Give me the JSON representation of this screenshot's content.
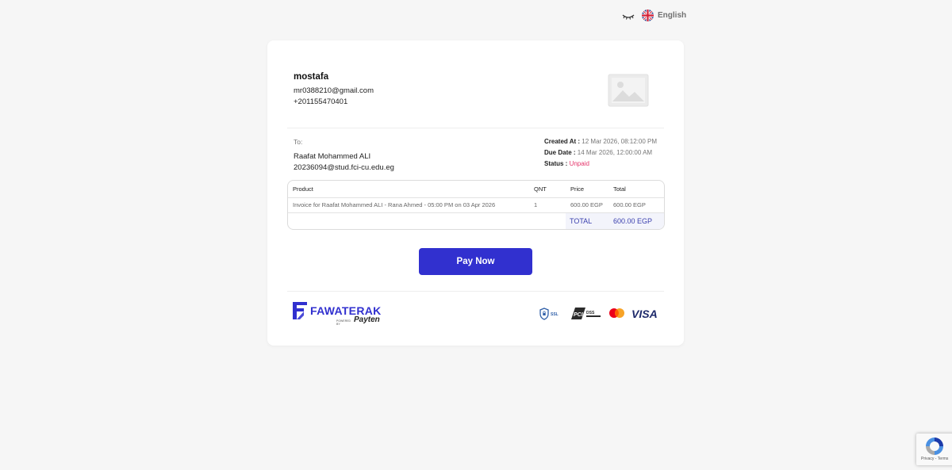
{
  "header": {
    "language": "English"
  },
  "sender": {
    "name": "mostafa",
    "email": "mr0388210@gmail.com",
    "phone": "+201155470401"
  },
  "recipient": {
    "label": "To:",
    "name": "Raafat Mohammed ALI",
    "email": "20236094@stud.fci-cu.edu.eg"
  },
  "meta": {
    "created_label": "Created At :",
    "created_value": "12 Mar 2026, 08:12:00 PM",
    "due_label": "Due Date :",
    "due_value": "14 Mar 2026, 12:00:00 AM",
    "status_label": "Status :",
    "status_value": "Unpaid"
  },
  "table": {
    "headers": [
      "Product",
      "QNT",
      "Price",
      "Total"
    ],
    "rows": [
      {
        "product": "Invoice for Raafat Mohammed ALI - Rana Ahmed - 05:00 PM on 03 Apr 2026",
        "qnt": "1",
        "price": "600.00 EGP",
        "total": "600.00 EGP"
      }
    ],
    "total_label": "TOTAL",
    "total_value": "600.00 EGP"
  },
  "actions": {
    "pay_label": "Pay Now"
  },
  "footer": {
    "brand": "FAWATERAK",
    "powered_by": "POWERED BY",
    "partner": "Payten",
    "badges": [
      "ssl-icon",
      "pci-dss-icon",
      "mastercard-icon"
    ],
    "visa": "VISA"
  },
  "recaptcha": {
    "links": "Privacy - Terms"
  },
  "colors": {
    "accent": "#3130cf",
    "status_unpaid": "#e5356b",
    "total_text": "#3a3fae",
    "background": "#f6f6f6"
  }
}
